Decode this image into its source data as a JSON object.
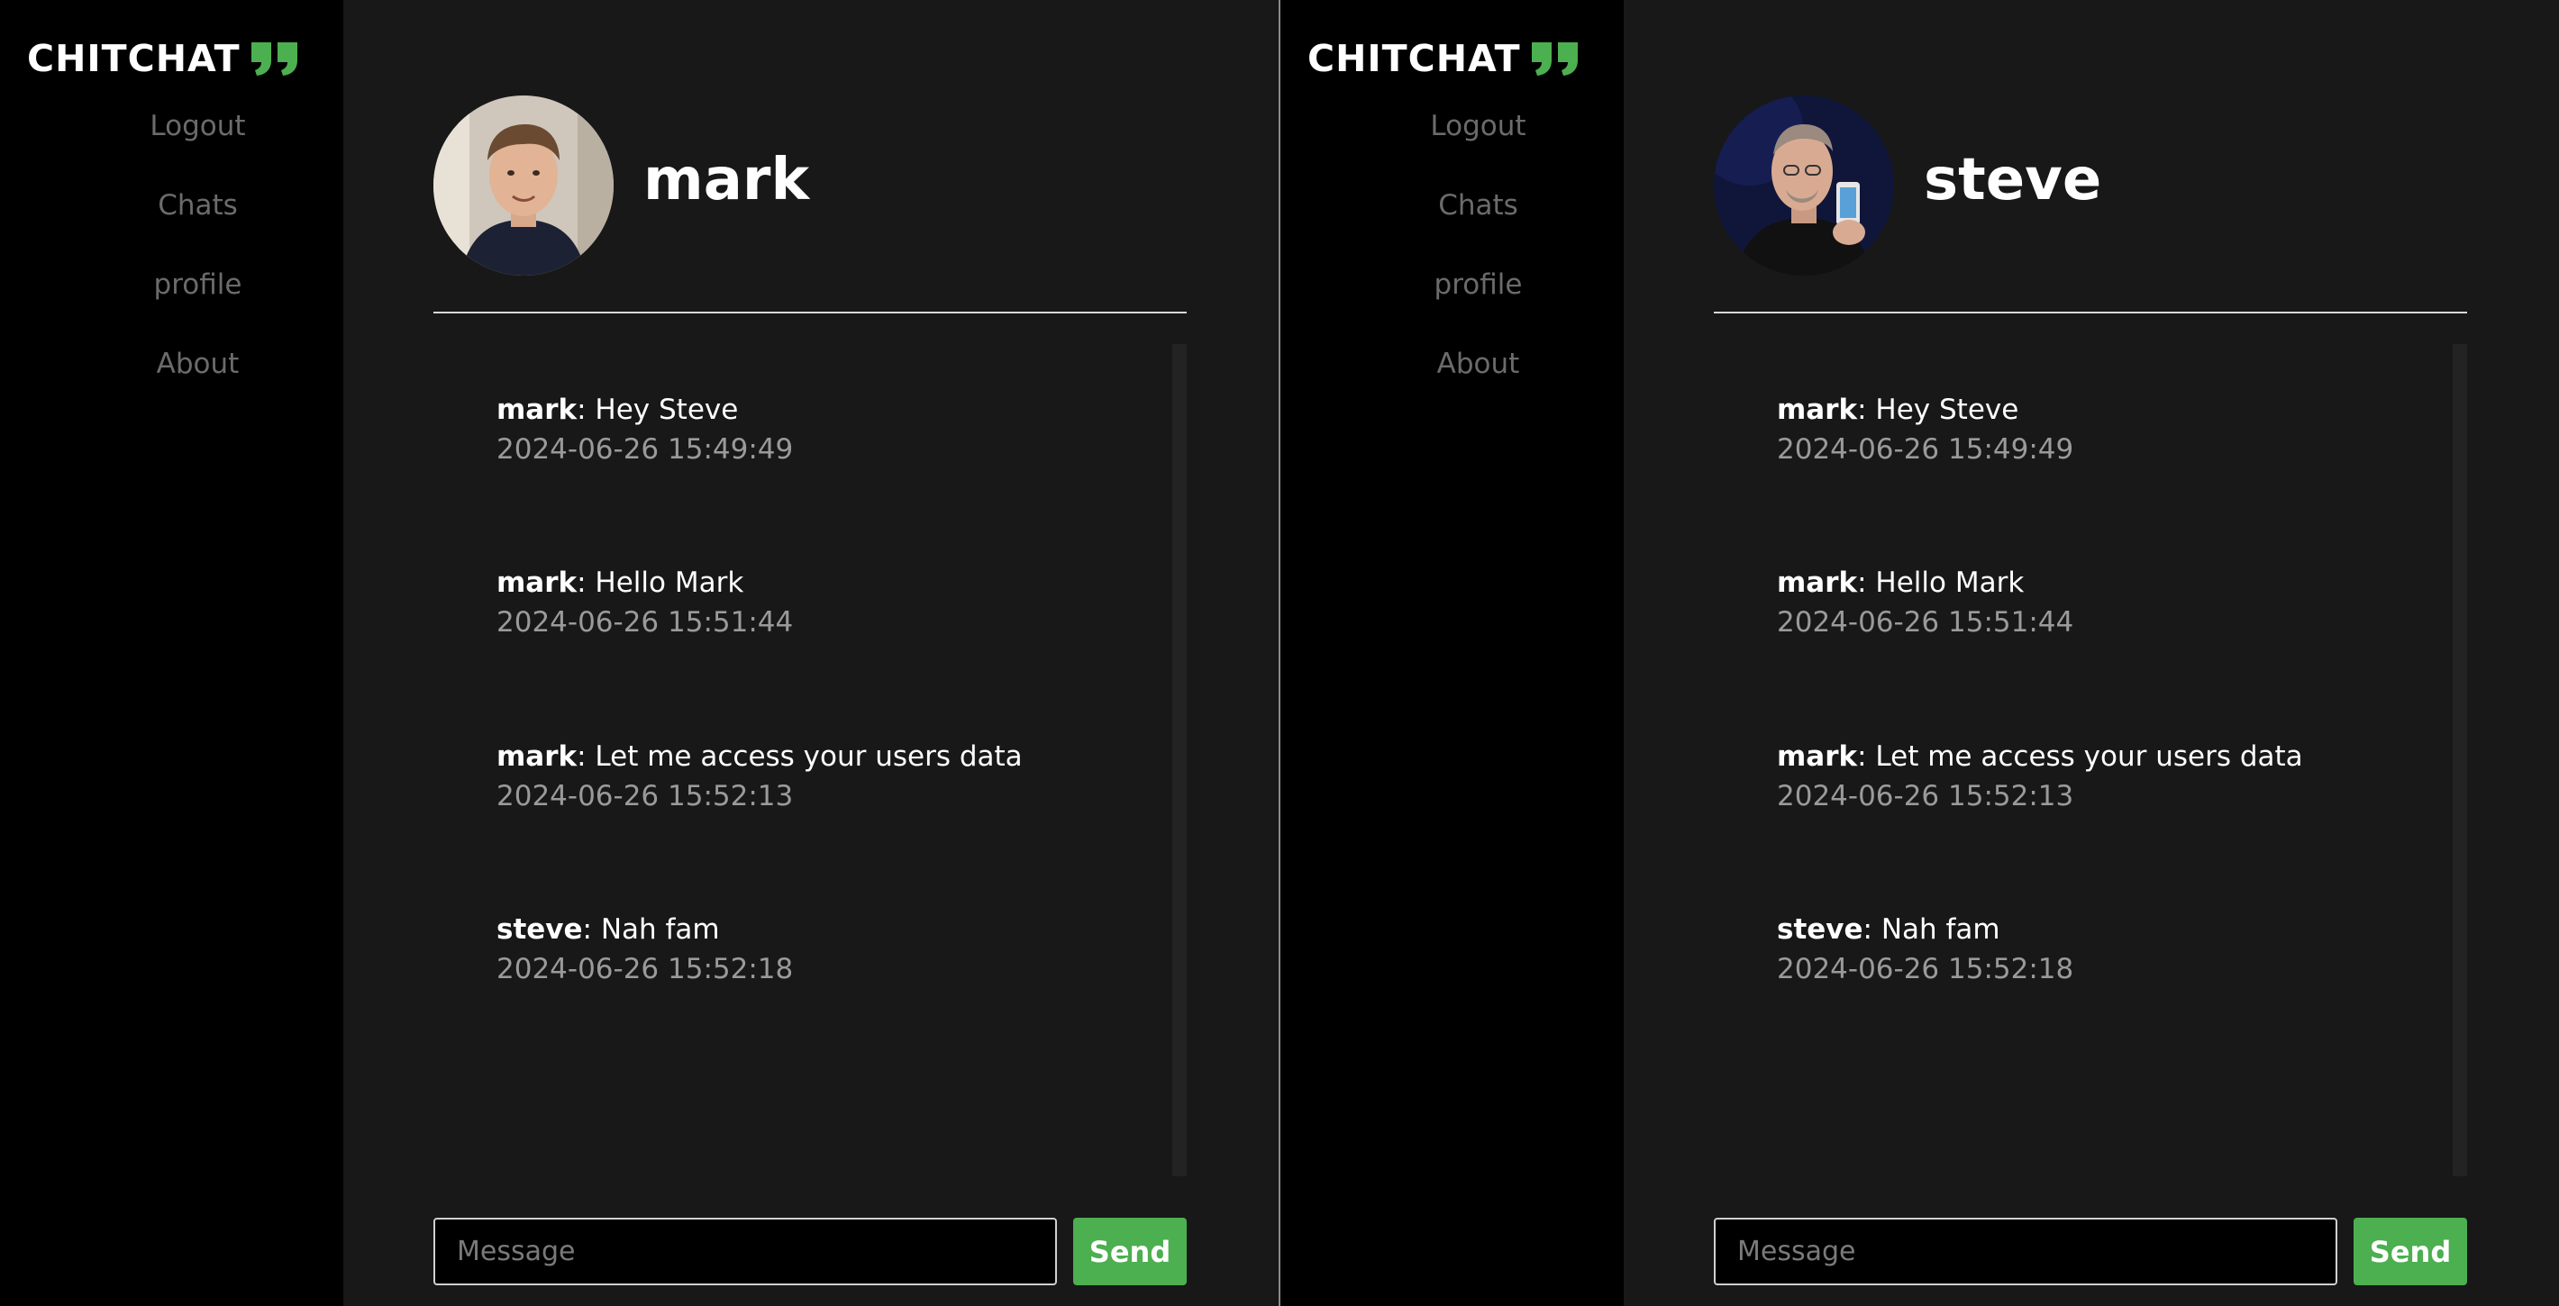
{
  "brand": {
    "name": "CHITCHAT",
    "accent_color": "#4caf50",
    "icon": "quote-icon"
  },
  "nav": [
    {
      "label": "Logout"
    },
    {
      "label": "Chats"
    },
    {
      "label": "profile"
    },
    {
      "label": "About"
    }
  ],
  "panes": [
    {
      "chat_partner": "mark",
      "messages": [
        {
          "user": "mark",
          "text": ": Hey Steve",
          "time": "2024-06-26 15:49:49"
        },
        {
          "user": "mark",
          "text": ": Hello Mark",
          "time": "2024-06-26 15:51:44"
        },
        {
          "user": "mark",
          "text": ": Let me access your users data",
          "time": "2024-06-26 15:52:13"
        },
        {
          "user": "steve",
          "text": ": Nah fam",
          "time": "2024-06-26 15:52:18"
        }
      ],
      "composer": {
        "placeholder": "Message",
        "send_label": "Send"
      }
    },
    {
      "chat_partner": "steve",
      "messages": [
        {
          "user": "mark",
          "text": ": Hey Steve",
          "time": "2024-06-26 15:49:49"
        },
        {
          "user": "mark",
          "text": ": Hello Mark",
          "time": "2024-06-26 15:51:44"
        },
        {
          "user": "mark",
          "text": ": Let me access your users data",
          "time": "2024-06-26 15:52:13"
        },
        {
          "user": "steve",
          "text": ": Nah fam",
          "time": "2024-06-26 15:52:18"
        }
      ],
      "composer": {
        "placeholder": "Message",
        "send_label": "Send"
      }
    }
  ]
}
